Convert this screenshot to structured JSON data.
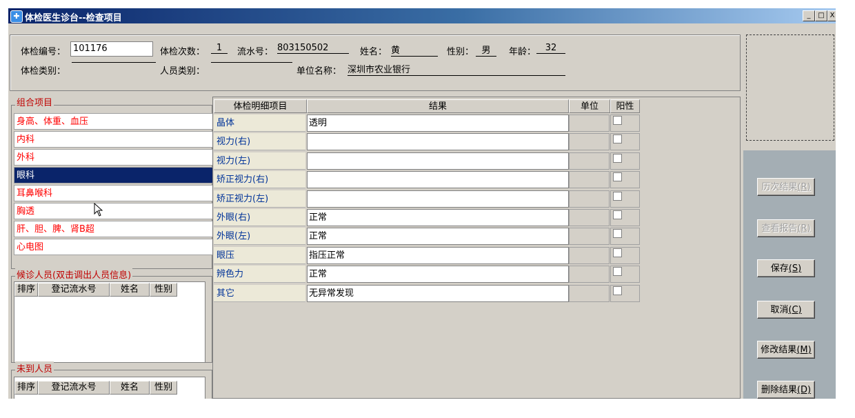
{
  "window": {
    "title": "体检医生诊台--检查项目",
    "buttons": {
      "minimize": "_",
      "maximize": "□",
      "close": "X"
    }
  },
  "header": {
    "exam_no_label": "体检编号：",
    "exam_no_value": "101176",
    "exam_count_label": "体检次数：",
    "exam_count_value": "1",
    "serial_label": "流水号：",
    "serial_value": "803150502",
    "name_label": "姓名：",
    "name_value": "黄",
    "gender_label": "性别：",
    "gender_value": "男",
    "age_label": "年龄：",
    "age_value": "32",
    "exam_type_label": "体检类别：",
    "exam_type_value": "",
    "person_type_label": "人员类别：",
    "person_type_value": "",
    "unit_label": "单位名称：",
    "unit_value": "深圳市农业银行"
  },
  "group_items": {
    "title": "组合项目",
    "items": [
      {
        "label": "身高、体重、血压",
        "selected": false
      },
      {
        "label": "内科",
        "selected": false
      },
      {
        "label": "外科",
        "selected": false
      },
      {
        "label": "眼科",
        "selected": true
      },
      {
        "label": "耳鼻喉科",
        "selected": false
      },
      {
        "label": "胸透",
        "selected": false
      },
      {
        "label": "肝、胆、脾、肾B超",
        "selected": false
      },
      {
        "label": "心电图",
        "selected": false
      }
    ]
  },
  "waiting": {
    "title": "候诊人员(双击调出人员信息)",
    "columns": [
      "排序",
      "登记流水号",
      "姓名",
      "性别"
    ]
  },
  "absent": {
    "title": "未到人员",
    "columns": [
      "排序",
      "登记流水号",
      "姓名",
      "性别"
    ]
  },
  "detail": {
    "columns": [
      "体检明细项目",
      "结果",
      "单位",
      "阳性"
    ],
    "rows": [
      {
        "item": "晶体",
        "result": "透明"
      },
      {
        "item": "视力(右)",
        "result": ""
      },
      {
        "item": "视力(左)",
        "result": ""
      },
      {
        "item": "矫正视力(右)",
        "result": ""
      },
      {
        "item": "矫正视力(左)",
        "result": ""
      },
      {
        "item": "外眼(右)",
        "result": "正常"
      },
      {
        "item": "外眼(左)",
        "result": "正常"
      },
      {
        "item": "眼压",
        "result": "指压正常"
      },
      {
        "item": "辨色力",
        "result": "正常"
      },
      {
        "item": "其它",
        "result": "无异常发现"
      }
    ]
  },
  "actions": {
    "history": {
      "text": "历次结果",
      "key": "(R)"
    },
    "report": {
      "text": "查看报告",
      "key": "(R)"
    },
    "save": {
      "text": "保存",
      "key": "(S)"
    },
    "cancel": {
      "text": "取消",
      "key": "(C)"
    },
    "modify": {
      "text": "修改结果",
      "key": "(M)"
    },
    "delete": {
      "text": "删除结果",
      "key": "(D)"
    }
  },
  "colors": {
    "title_bar": "#0a246a",
    "selected": "#0a246a",
    "group_text": "#ff0000",
    "label_blue": "#003399"
  }
}
